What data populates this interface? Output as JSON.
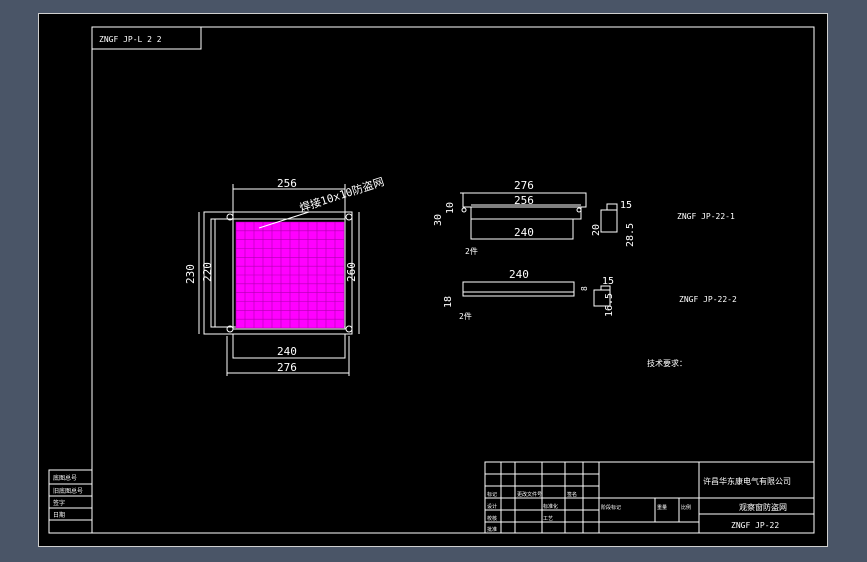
{
  "drawing": {
    "code_block": "ZNGF JP-L 2 2",
    "title_block": {
      "company": "许昌华东康电气有限公司",
      "part_name": "观察窗防盗网",
      "code": "ZNGF JP-22",
      "header_cols": [
        "标记",
        "处数",
        "分区",
        "更改文件号",
        "签名",
        "年月日"
      ],
      "row_labels": [
        "设计",
        "校核",
        "审核",
        "工艺",
        "标准化",
        "批准"
      ],
      "small_labels": [
        "阶段标记",
        "重量",
        "比例",
        "共",
        "张",
        "第",
        "张"
      ],
      "left_stamps": [
        "底图总号",
        "旧底图总号",
        "签字",
        "日期"
      ]
    },
    "notes": {
      "tech_req": "技术要求：",
      "mesh_label": "焊接10x10防盗网"
    },
    "views": {
      "front": {
        "top_dim": "256",
        "left_outer": "230",
        "left_inner": "220",
        "right_dim": "260",
        "bottom_inner": "240",
        "bottom_outer": "276"
      },
      "part1": {
        "dim_top": "276",
        "dim_mid": "256",
        "dim_bottom": "240",
        "dim_left_a": "30",
        "dim_left_b": "10",
        "qty": "2件",
        "label": "ZNGF JP-22-1",
        "side_w": "15",
        "side_h": "20",
        "side_h2": "28.5"
      },
      "part2": {
        "dim_top": "240",
        "dim_left": "18",
        "qty": "2件",
        "label": "ZNGF JP-22-2",
        "side_w": "15",
        "side_a": "8",
        "side_h": "16.5"
      }
    },
    "colors": {
      "mesh": "#ff00ff",
      "line": "#ffffff",
      "sheet": "#000000",
      "background": "#4a5567"
    }
  }
}
